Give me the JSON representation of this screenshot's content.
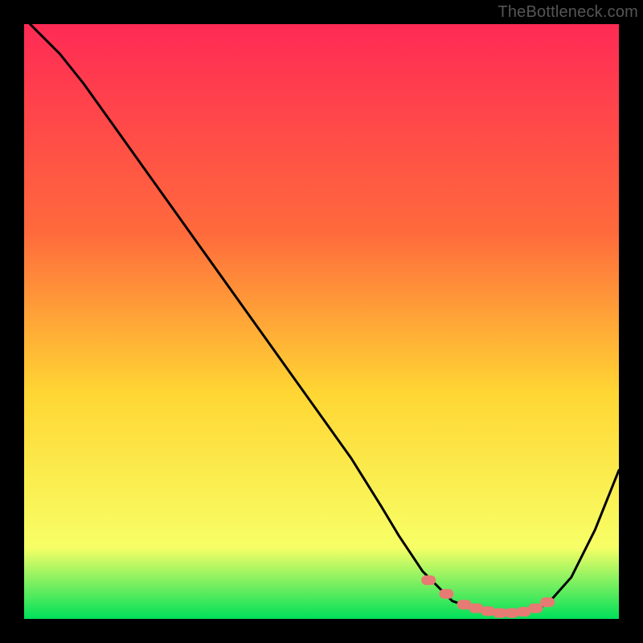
{
  "watermark": "TheBottleneck.com",
  "colors": {
    "gradient_top": "#ff2a55",
    "gradient_mid1": "#ff6a3c",
    "gradient_mid2": "#ffd633",
    "gradient_mid3": "#f7ff66",
    "gradient_bottom": "#00e05a",
    "curve": "#000000",
    "markers": "#e77a72",
    "frame": "#000000"
  },
  "chart_data": {
    "type": "line",
    "title": "",
    "xlabel": "",
    "ylabel": "",
    "xlim": [
      0,
      100
    ],
    "ylim": [
      0,
      100
    ],
    "legend": false,
    "grid": false,
    "series": [
      {
        "name": "bottleneck-curve",
        "x": [
          1,
          3,
          6,
          10,
          15,
          20,
          25,
          30,
          35,
          40,
          45,
          50,
          55,
          60,
          63,
          65,
          67,
          70,
          72,
          75,
          78,
          80,
          83,
          85,
          88,
          92,
          96,
          100
        ],
        "y": [
          100,
          98,
          95,
          90,
          83,
          76,
          69,
          62,
          55,
          48,
          41,
          34,
          27,
          19,
          14,
          11,
          8,
          5,
          3,
          2,
          1.2,
          1,
          1,
          1.3,
          2.5,
          7,
          15,
          25
        ]
      }
    ],
    "markers": {
      "name": "optimal-band",
      "x": [
        68,
        71,
        74,
        76,
        78,
        80,
        82,
        84,
        86,
        88
      ],
      "y": [
        6.5,
        4.2,
        2.4,
        1.8,
        1.3,
        1.0,
        1.0,
        1.2,
        1.8,
        2.8
      ]
    }
  }
}
